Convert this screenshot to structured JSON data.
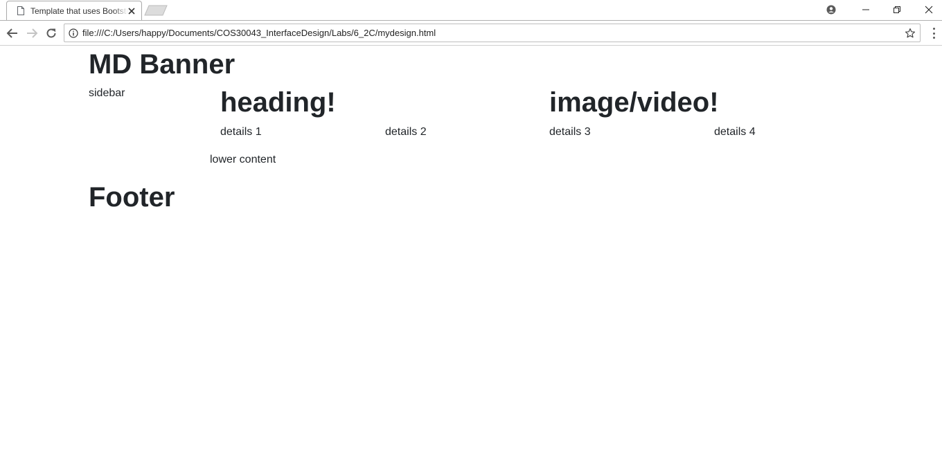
{
  "browser": {
    "tab": {
      "title": "Template that uses Bootstrap"
    },
    "address_bar": {
      "url": "file:///C:/Users/happy/Documents/COS30043_InterfaceDesign/Labs/6_2C/mydesign.html"
    },
    "icons": [
      "document-icon",
      "close-icon",
      "new-tab-icon",
      "account-icon",
      "minimize-icon",
      "restore-icon",
      "window-close-icon",
      "back-icon",
      "forward-icon",
      "reload-icon",
      "info-icon",
      "star-icon",
      "menu-icon"
    ]
  },
  "page": {
    "banner": "MD Banner",
    "sidebar": "sidebar",
    "main": {
      "heading_left": "heading!",
      "heading_right": "image/video!",
      "details": [
        "details 1",
        "details 2",
        "details 3",
        "details 4"
      ]
    },
    "lower_content": "lower content",
    "footer": "Footer"
  },
  "colors": {
    "text": "#212529",
    "chrome_icon": "#5a5a5a",
    "background": "#ffffff"
  }
}
